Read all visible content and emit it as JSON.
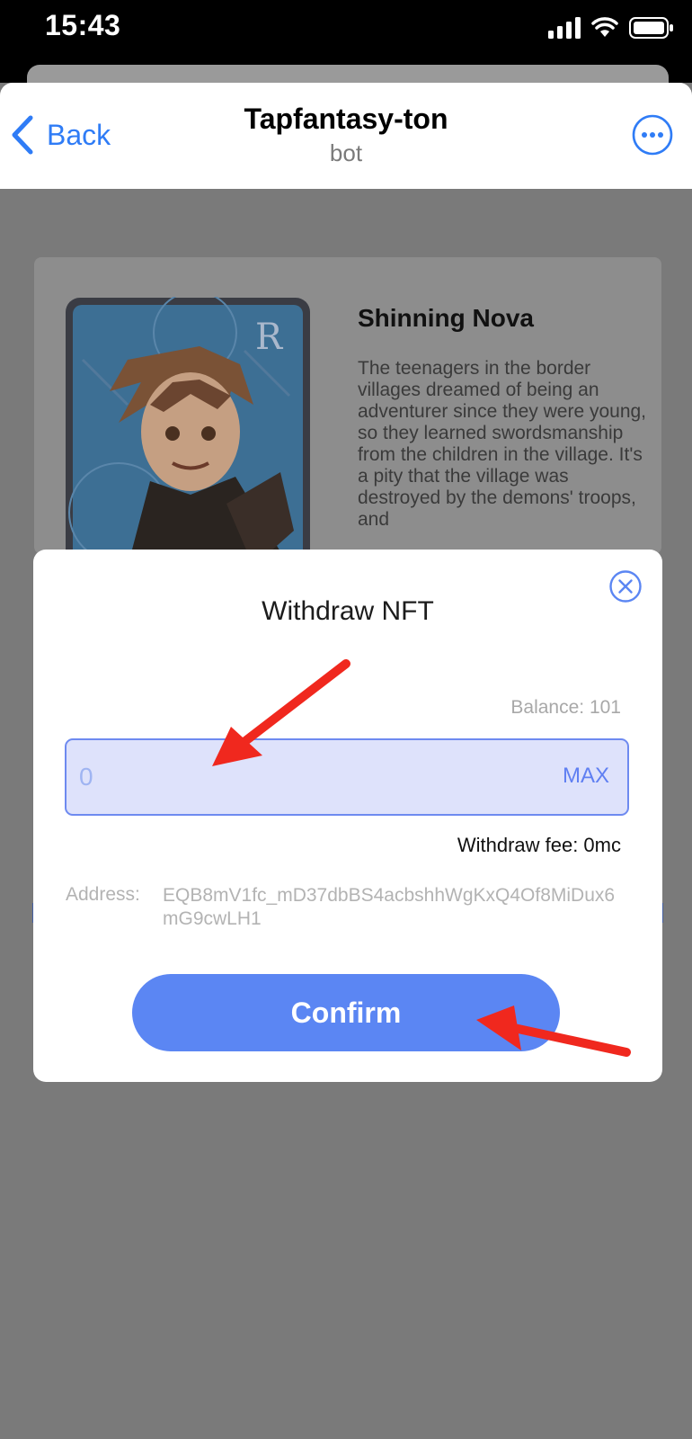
{
  "status_bar": {
    "time": "15:43",
    "icons": [
      "signal-icon",
      "wifi-icon",
      "battery-icon"
    ]
  },
  "header": {
    "back_label": "Back",
    "title": "Tapfantasy-ton",
    "subtitle": "bot",
    "icons": [
      "back-chevron-icon",
      "more-options-icon"
    ]
  },
  "nft": {
    "rarity_mark": "R",
    "name": "Shinning Nova",
    "description": "The teenagers in the border villages dreamed of being an adventurer since they were young, so they learned swordsmanship from the children in the village. It's a pity that the village was destroyed by the demons' troops, and"
  },
  "modal": {
    "title": "Withdraw NFT",
    "balance": "Balance: 101",
    "amount_placeholder": "0",
    "max_label": "MAX",
    "fee": "Withdraw fee: 0mc",
    "address_label": "Address:",
    "address_value": "EQB8mV1fc_mD37dbBS4acbshhWgKxQ4Of8MiDux6mG9cwLH1",
    "confirm_label": "Confirm",
    "close_icon": "close-circle-icon"
  },
  "colors": {
    "accent": "#2f7cf6",
    "input_fill": "#dee2fb",
    "input_border": "#6e8af0",
    "confirm_button": "#5b86f3",
    "overlay": "#7a7a7a",
    "annotation_arrow": "#f0281e"
  }
}
